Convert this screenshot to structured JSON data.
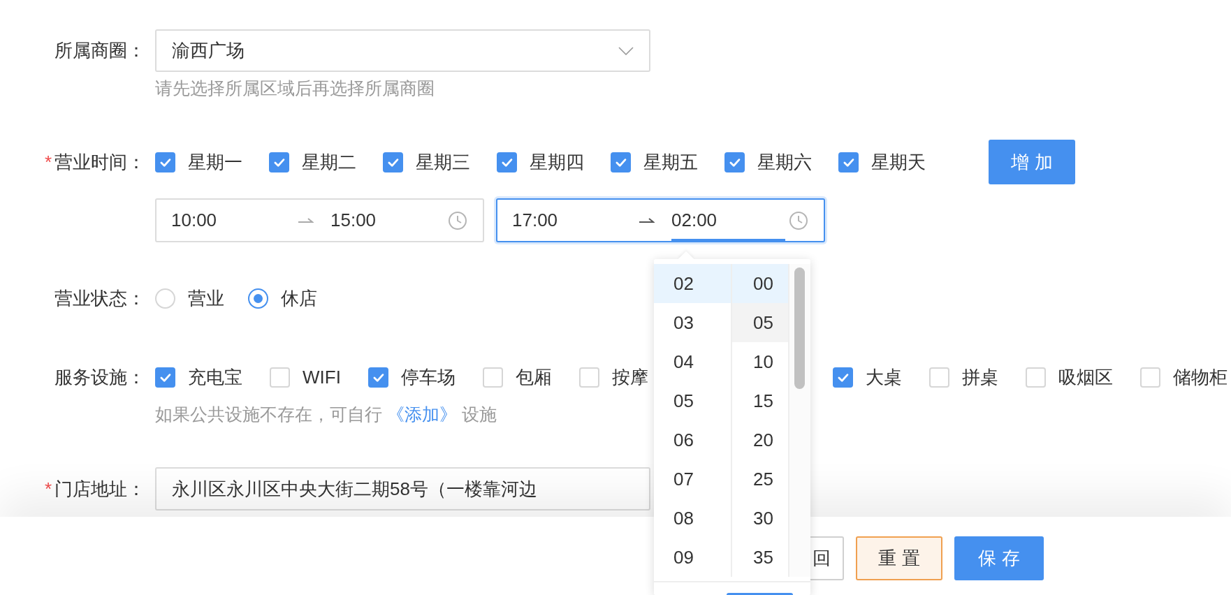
{
  "business_district": {
    "label": "所属商圈：",
    "value": "渝西广场",
    "hint": "请先选择所属区域后再选择所属商圈"
  },
  "business_hours": {
    "label": "营业时间：",
    "required_mark": "*",
    "add_button": "增 加",
    "days": [
      {
        "label": "星期一",
        "checked": true
      },
      {
        "label": "星期二",
        "checked": true
      },
      {
        "label": "星期三",
        "checked": true
      },
      {
        "label": "星期四",
        "checked": true
      },
      {
        "label": "星期五",
        "checked": true
      },
      {
        "label": "星期六",
        "checked": true
      },
      {
        "label": "星期天",
        "checked": true
      }
    ],
    "ranges": [
      {
        "start": "10:00",
        "end": "15:00",
        "focused": false
      },
      {
        "start": "17:00",
        "end": "02:00",
        "focused": true
      }
    ]
  },
  "business_status": {
    "label": "营业状态：",
    "options": [
      {
        "label": "营业",
        "selected": false
      },
      {
        "label": "休店",
        "selected": true
      }
    ]
  },
  "facilities": {
    "label": "服务设施：",
    "items": [
      {
        "label": "充电宝",
        "checked": true
      },
      {
        "label": "WIFI",
        "checked": false
      },
      {
        "label": "停车场",
        "checked": true
      },
      {
        "label": "包厢",
        "checked": false
      },
      {
        "label": "按摩",
        "checked": false
      },
      {
        "label": "大桌",
        "checked": true
      },
      {
        "label": "拼桌",
        "checked": false
      },
      {
        "label": "吸烟区",
        "checked": false
      },
      {
        "label": "储物柜",
        "checked": false
      }
    ],
    "hint_before": "如果公共设施不存在，可自行",
    "hint_link": "《添加》",
    "hint_after": "设施"
  },
  "address": {
    "label": "门店地址：",
    "required_mark": "*",
    "value": "永川区永川区中央大街二期58号（一楼靠河边"
  },
  "time_panel": {
    "hours": [
      {
        "label": "02",
        "selected": true
      },
      {
        "label": "03",
        "selected": false
      },
      {
        "label": "04",
        "selected": false
      },
      {
        "label": "05",
        "selected": false
      },
      {
        "label": "06",
        "selected": false
      },
      {
        "label": "07",
        "selected": false
      },
      {
        "label": "08",
        "selected": false
      },
      {
        "label": "09",
        "selected": false
      }
    ],
    "minutes": [
      {
        "label": "00",
        "selected": true,
        "hovered": false
      },
      {
        "label": "05",
        "selected": false,
        "hovered": true
      },
      {
        "label": "10",
        "selected": false,
        "hovered": false
      },
      {
        "label": "15",
        "selected": false,
        "hovered": false
      },
      {
        "label": "20",
        "selected": false,
        "hovered": false
      },
      {
        "label": "25",
        "selected": false,
        "hovered": false
      },
      {
        "label": "30",
        "selected": false,
        "hovered": false
      },
      {
        "label": "35",
        "selected": false,
        "hovered": false
      }
    ]
  },
  "footer_buttons": [
    {
      "label": "回",
      "kind": "default"
    },
    {
      "label": "重 置",
      "kind": "warning"
    },
    {
      "label": "保 存",
      "kind": "primary"
    }
  ]
}
